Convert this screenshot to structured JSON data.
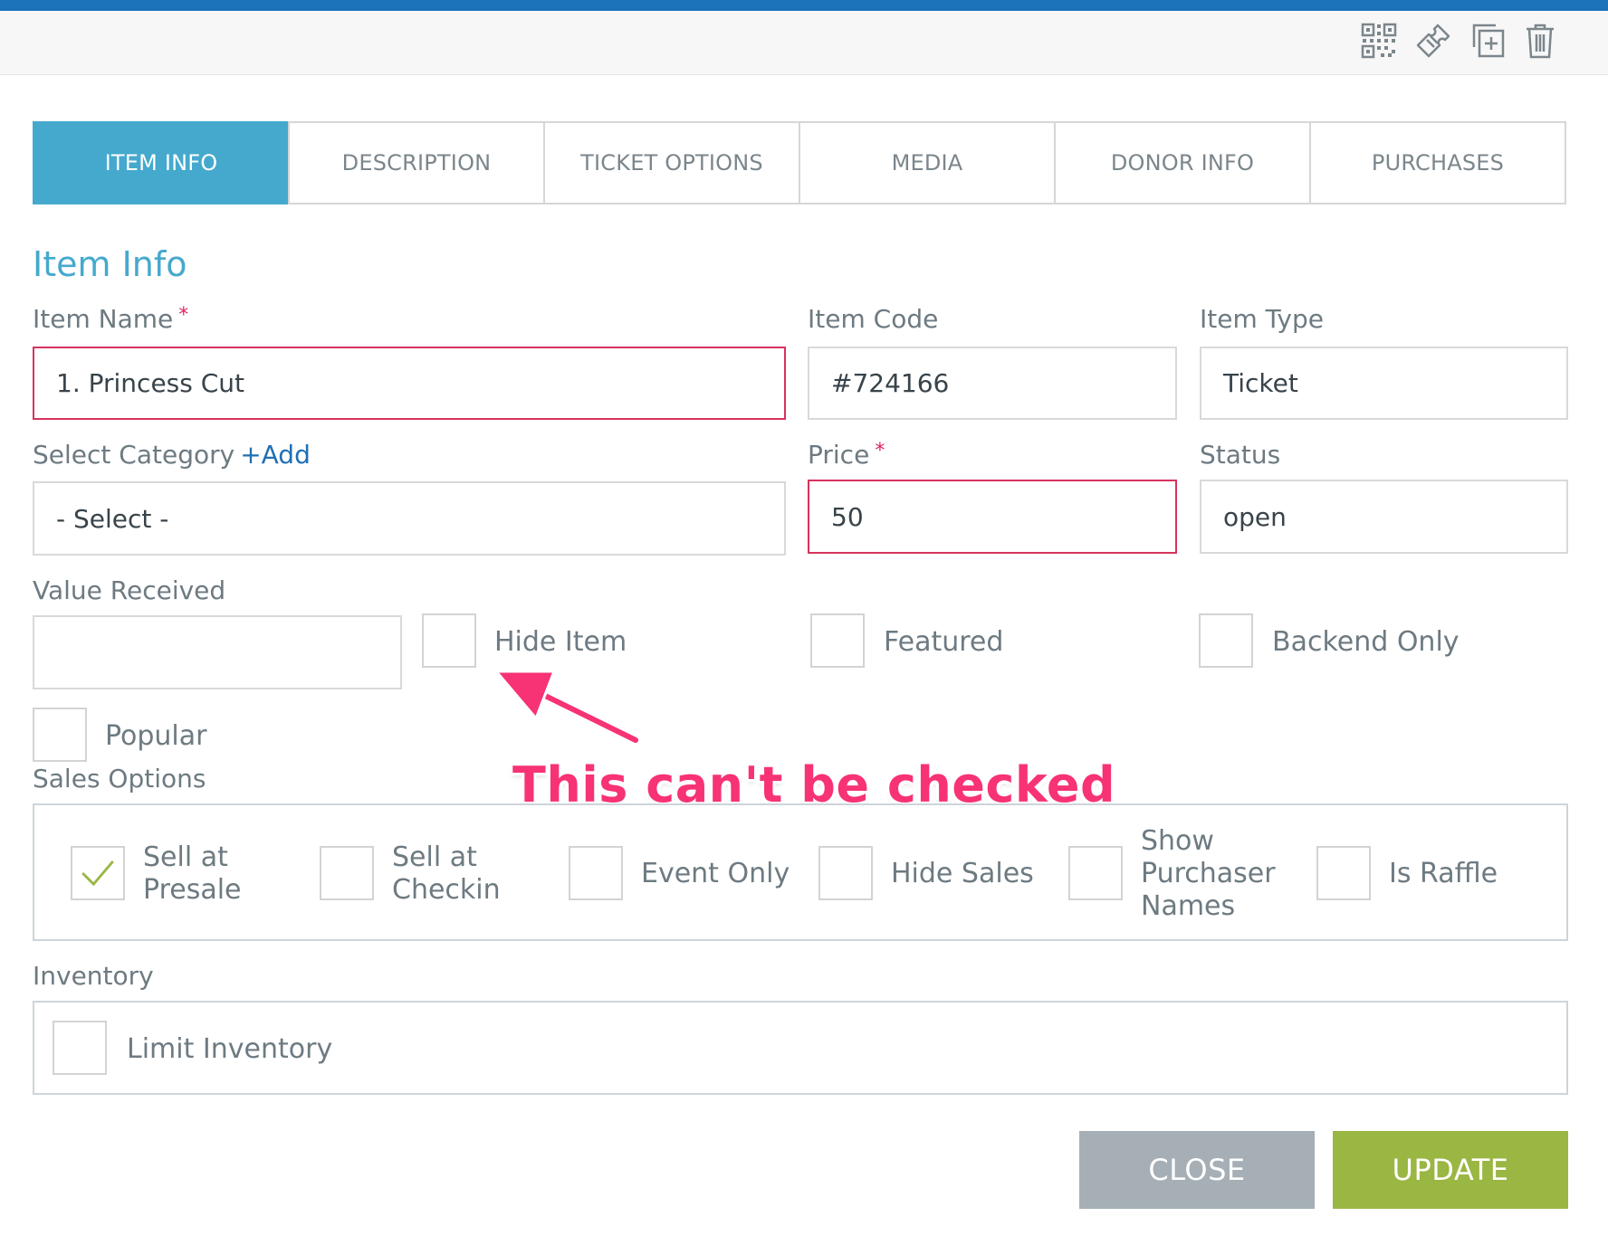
{
  "colors": {
    "top_band": "#1d73b9",
    "tab_active": "#45a9cd",
    "section_title": "#45a9cd",
    "error_border": "#d6335e",
    "required_mark": "#e0245e",
    "add_link": "#1f6fb5",
    "check_mark": "#9ab643",
    "callout": "#f73275",
    "close_button": "#a5afb5",
    "update_button": "#9ab643"
  },
  "toolbar": {
    "icons": [
      "qr-code-icon",
      "ticket-icon",
      "duplicate-icon",
      "trash-icon"
    ]
  },
  "tabs": [
    {
      "label": "ITEM INFO",
      "active": true
    },
    {
      "label": "DESCRIPTION",
      "active": false
    },
    {
      "label": "TICKET OPTIONS",
      "active": false
    },
    {
      "label": "MEDIA",
      "active": false
    },
    {
      "label": "DONOR INFO",
      "active": false
    },
    {
      "label": "PURCHASES",
      "active": false
    }
  ],
  "section_title": "Item Info",
  "fields": {
    "item_name": {
      "label": "Item Name",
      "required_mark": "*",
      "value": "1. Princess Cut"
    },
    "item_code": {
      "label": "Item Code",
      "value": "#724166"
    },
    "item_type": {
      "label": "Item Type",
      "value": "Ticket"
    },
    "category": {
      "label": "Select Category",
      "add_link": "+Add",
      "value": "- Select -"
    },
    "price": {
      "label": "Price",
      "required_mark": "*",
      "value": "50"
    },
    "status": {
      "label": "Status",
      "value": "open"
    },
    "value_received": {
      "label": "Value Received",
      "value": ""
    }
  },
  "flags": [
    {
      "label": "Hide Item",
      "checked": false
    },
    {
      "label": "Featured",
      "checked": false
    },
    {
      "label": "Backend Only",
      "checked": false
    },
    {
      "label": "Popular",
      "checked": false
    }
  ],
  "sales_options": {
    "label": "Sales Options",
    "items": [
      {
        "label": "Sell at Presale",
        "checked": true
      },
      {
        "label": "Sell at Checkin",
        "checked": false
      },
      {
        "label": "Event Only",
        "checked": false
      },
      {
        "label": "Hide Sales",
        "checked": false
      },
      {
        "label": "Show Purchaser Names",
        "checked": false
      },
      {
        "label": "Is Raffle",
        "checked": false
      }
    ]
  },
  "inventory": {
    "label": "Inventory",
    "limit_label": "Limit Inventory",
    "checked": false
  },
  "annotation": {
    "text": "This can't be checked"
  },
  "buttons": {
    "close": "CLOSE",
    "update": "UPDATE"
  }
}
